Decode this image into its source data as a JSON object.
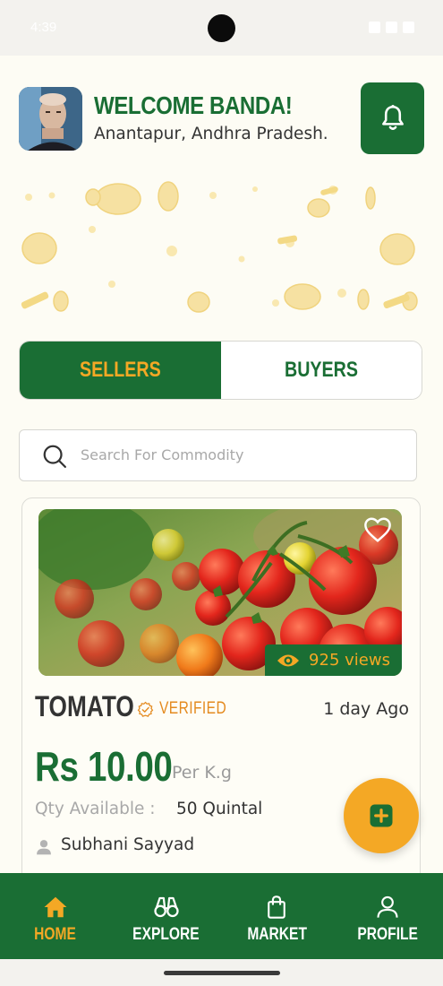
{
  "status_bar": {
    "time": "4:39"
  },
  "header": {
    "welcome": "WELCOME BANDA!",
    "location": "Anantapur, Andhra Pradesh."
  },
  "tabs": [
    {
      "label": "SELLERS",
      "active": true
    },
    {
      "label": "BUYERS",
      "active": false
    }
  ],
  "search": {
    "placeholder": "Search For Commodity",
    "value": ""
  },
  "listing": {
    "product": "TOMATO",
    "verified_label": "VERIFIED",
    "posted": "1 day Ago",
    "views": "925 views",
    "price": "Rs 10.00",
    "unit": "Per K.g",
    "qty_label": "Qty Available :",
    "qty_value": "50 Quintal",
    "seller": "Subhani Sayyad"
  },
  "nav": [
    {
      "label": "HOME",
      "icon": "home-icon",
      "active": true
    },
    {
      "label": "EXPLORE",
      "icon": "binoculars-icon",
      "active": false
    },
    {
      "label": "MARKET",
      "icon": "shopping-bag-icon",
      "active": false
    },
    {
      "label": "PROFILE",
      "icon": "profile-icon",
      "active": false
    }
  ],
  "colors": {
    "primary_green": "#1a6e34",
    "accent_orange": "#f4a825",
    "verified_orange": "#e48a1f",
    "background": "#fdfcf4"
  }
}
